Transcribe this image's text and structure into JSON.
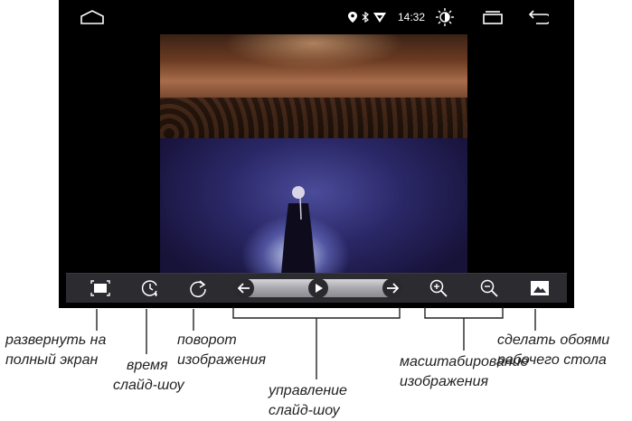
{
  "status_bar": {
    "time": "14:32",
    "icons": [
      "home-icon",
      "location-icon",
      "bluetooth-icon",
      "signal-icon",
      "brightness-icon",
      "recent-apps-icon",
      "back-icon"
    ]
  },
  "toolbar": {
    "buttons": [
      "fullscreen-icon",
      "slideshow-timer-icon",
      "rotate-icon",
      "previous-icon",
      "play-icon",
      "next-icon",
      "zoom-in-icon",
      "zoom-out-icon",
      "set-wallpaper-icon"
    ]
  },
  "annotations": {
    "fullscreen": [
      "развернуть на",
      "полный экран"
    ],
    "slideshow_time": [
      "время",
      "слайд-шоу"
    ],
    "rotate": [
      "поворот",
      "изображения"
    ],
    "slideshow_control": [
      "управление",
      "слайд-шоу"
    ],
    "zoom": [
      "масштабирование",
      "изображения"
    ],
    "wallpaper": [
      "сделать обоями",
      "рабочего стола"
    ]
  },
  "colors": {
    "screen_bg": "#000000",
    "toolbar_bg": "#2c2c30",
    "icon_color": "#ffffff",
    "callout_line": "#222222"
  }
}
